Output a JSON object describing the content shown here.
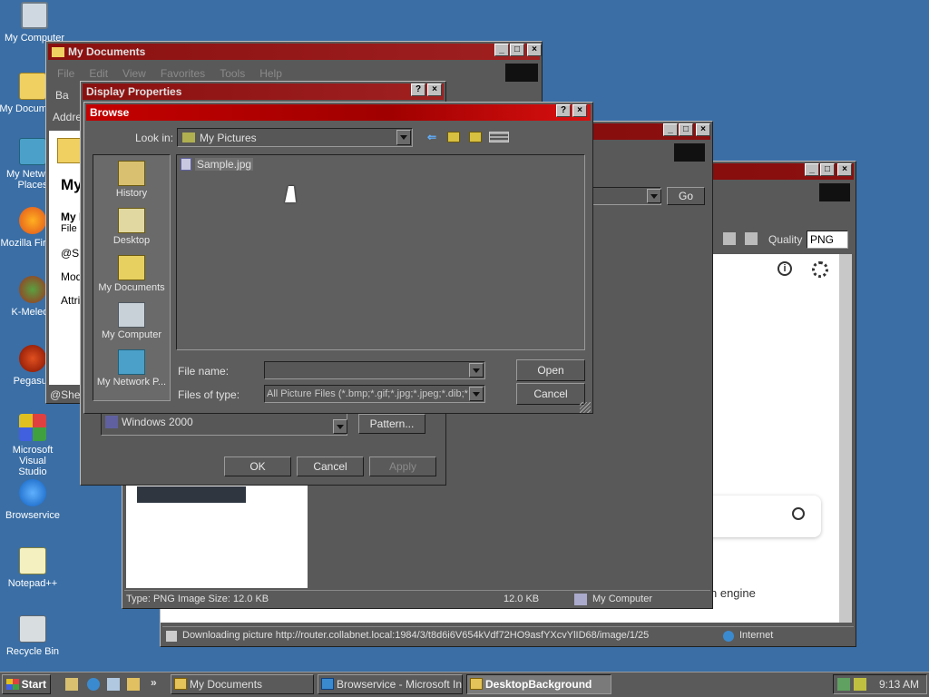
{
  "desktop": {
    "icons": [
      {
        "label": "My Computer"
      },
      {
        "label": "My Documents"
      },
      {
        "label": "My Network Places"
      },
      {
        "label": "Mozilla Firefox"
      },
      {
        "label": "K-Meleon"
      },
      {
        "label": "Pegasus"
      },
      {
        "label": "Microsoft Visual Studio"
      },
      {
        "label": "Browservice"
      },
      {
        "label": "Notepad++"
      },
      {
        "label": "Recycle Bin"
      }
    ]
  },
  "my_documents": {
    "title": "My Documents",
    "menu": [
      "File",
      "Edit",
      "View",
      "Favorites",
      "Tools",
      "Help"
    ],
    "back": "Ba",
    "address": "Addre",
    "heading": "My",
    "sub1": "My D",
    "sub2": "File F",
    "shell": "@Sh",
    "mod": "Mod",
    "attr": "Attrib",
    "status": "@Shel"
  },
  "mid_window": {
    "status_type": "Type: PNG Image Size: 12.0 KB",
    "status_size": "12.0 KB",
    "status_zone": "My Computer",
    "go": "Go"
  },
  "browser": {
    "quality_label": "Quality",
    "quality_value": "PNG",
    "search_text": "n engine",
    "status": "Downloading picture http://router.collabnet.local:1984/3/t8d6i6V654kVdf72HO9asfYXcvYlID68/image/1/25",
    "zone": "Internet"
  },
  "display_properties": {
    "title": "Display Properties",
    "wallpaper_item": "Windows 2000",
    "pattern_btn": "Pattern...",
    "ok": "OK",
    "cancel": "Cancel",
    "apply": "Apply"
  },
  "browse": {
    "title": "Browse",
    "look_in_label": "Look in:",
    "look_in_value": "My Pictures",
    "places": [
      "History",
      "Desktop",
      "My Documents",
      "My Computer",
      "My Network P..."
    ],
    "file": "Sample.jpg",
    "filename_label": "File name:",
    "filename_value": "",
    "filetype_label": "Files of type:",
    "filetype_value": "All Picture Files (*.bmp;*.gif;*.jpg;*.jpeg;*.dib;*.pn",
    "open": "Open",
    "cancel": "Cancel"
  },
  "taskbar": {
    "start": "Start",
    "tasks": [
      "My Documents",
      "Browservice - Microsoft Int...",
      "DesktopBackground"
    ],
    "clock": "9:13 AM"
  },
  "colors": {
    "desktop": "#3a6ea5",
    "title_active": "#c40000",
    "window_body": "#595959"
  }
}
